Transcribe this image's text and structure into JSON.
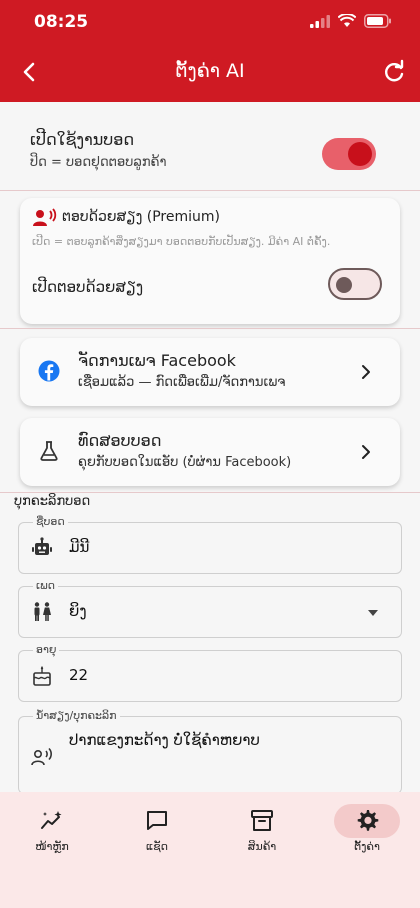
{
  "status_bar": {
    "time": "08:25"
  },
  "app_bar": {
    "title": "ຕັ້ງຄ່າ AI"
  },
  "bot_enable": {
    "title": "ເປີດໃຊ້ງານບອດ",
    "subtitle": "ປິດ = ບອດຢຸດຕອບລູກຄ້າ",
    "enabled": true
  },
  "voice_card": {
    "title": "ຕອບດ້ວຍສຽງ (Premium)",
    "subtitle": "ເປີດ = ຕອບລູກຄ້າສິ່ງສຽງມາ ບອດຕອບກັບເປັນສຽງ. ມີຄ່າ AI ຕໍ່ຄັ້ງ.",
    "toggle_label": "ເປີດຕອບດ້ວຍສຽງ",
    "enabled": false
  },
  "facebook_card": {
    "title": "ຈັດການເພຈ Facebook",
    "subtitle": "ເຊື່ອມແລ້ວ — ກົດເພື່ອເພີ່ມ/ຈັດການເພຈ"
  },
  "test_card": {
    "title": "ທົດສອບບອດ",
    "subtitle": "ຄຸຍກັບບອດໃນແອັບ (ບໍ່ຜ່ານ Facebook)"
  },
  "personality": {
    "section_label": "ບຸກຄະລິກບອດ",
    "name_label": "ຊື່ບອດ",
    "name_value": "ມີນີ",
    "gender_label": "ເພດ",
    "gender_value": "ຍິງ",
    "age_label": "ອາຍຸ",
    "age_value": "22",
    "tone_label": "ນ້ຳສຽງ/ບຸກຄະລິກ",
    "tone_value": "ປາກແຂງກະດ້າງ ບໍ່ໃຊ້ຄຳຫຍາບ"
  },
  "bottom_nav": {
    "tabs": [
      {
        "label": "ໜ້າຫຼັກ",
        "icon": "sparkle-chart-icon"
      },
      {
        "label": "ແຊັດ",
        "icon": "chat-bubble-icon"
      },
      {
        "label": "ສິນຄ້າ",
        "icon": "archive-box-icon"
      },
      {
        "label": "ຕັ້ງຄ່າ",
        "icon": "gear-icon"
      }
    ],
    "active_index": 3
  },
  "colors": {
    "brand_red": "#cf1a23",
    "toggle_on_track": "#e8606a",
    "toggle_on_knob": "#c8101b",
    "nav_background": "#fbe8e8",
    "nav_active_pill": "#f3caca"
  }
}
